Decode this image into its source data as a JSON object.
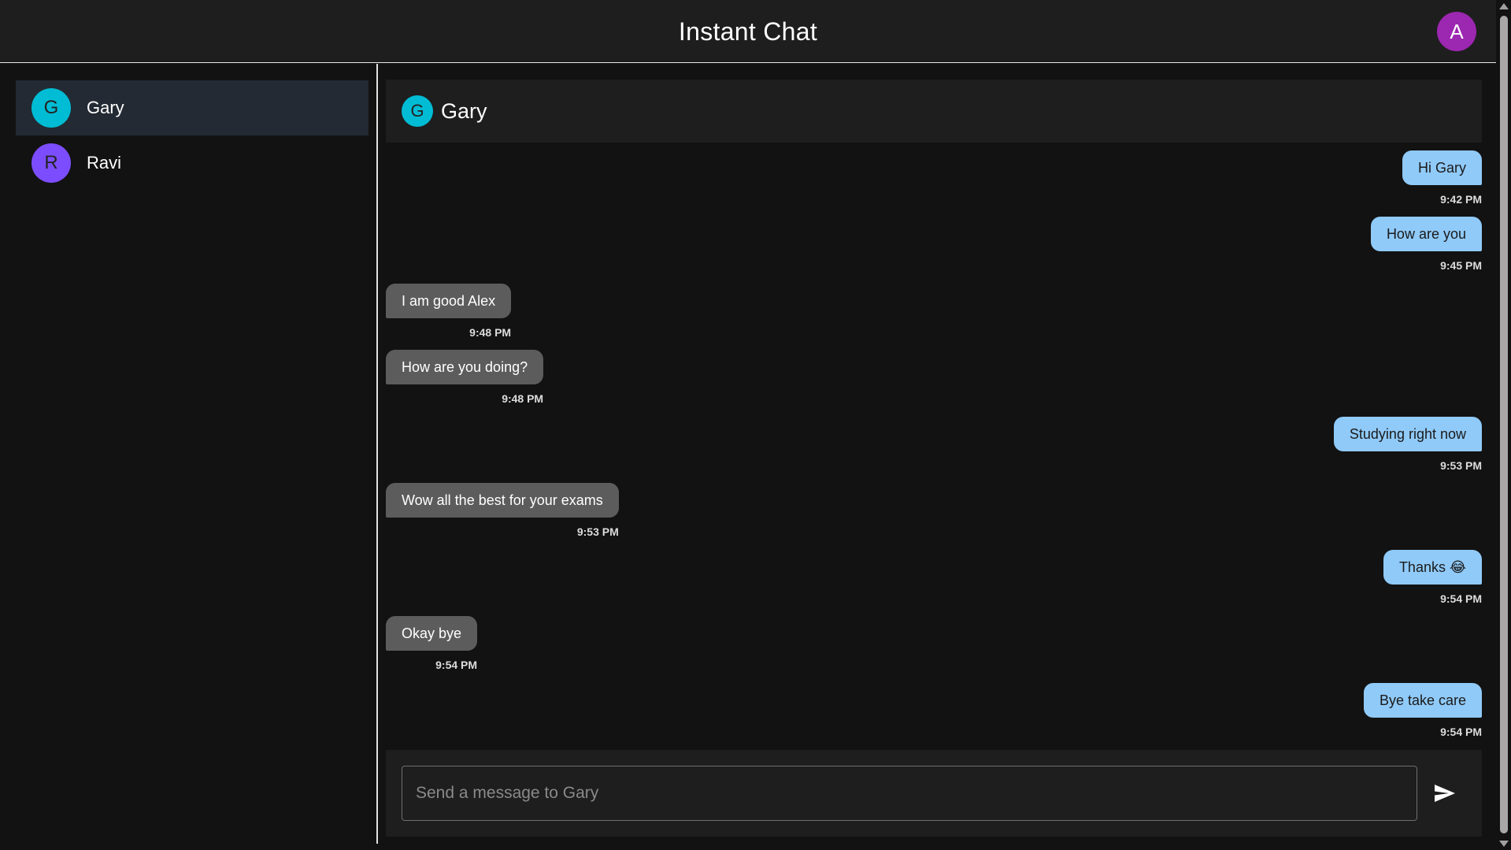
{
  "app": {
    "title": "Instant Chat"
  },
  "user": {
    "initial": "A",
    "avatar_color": "#9c27b0"
  },
  "contacts": [
    {
      "initial": "G",
      "name": "Gary",
      "avatar_color": "#00bcd4",
      "active": true
    },
    {
      "initial": "R",
      "name": "Ravi",
      "avatar_color": "#7c4dff",
      "active": false
    }
  ],
  "chat": {
    "contact_initial": "G",
    "contact_name": "Gary",
    "contact_color": "#00bcd4",
    "messages": [
      {
        "direction": "out",
        "text": "Hi Gary",
        "time": "9:42 PM"
      },
      {
        "direction": "out",
        "text": "How are you",
        "time": "9:45 PM"
      },
      {
        "direction": "in",
        "text": "I am good Alex",
        "time": "9:48 PM"
      },
      {
        "direction": "in",
        "text": "How are you doing?",
        "time": "9:48 PM"
      },
      {
        "direction": "out",
        "text": "Studying right now",
        "time": "9:53 PM"
      },
      {
        "direction": "in",
        "text": "Wow all the best for your exams",
        "time": "9:53 PM"
      },
      {
        "direction": "out",
        "text": "Thanks 😂",
        "time": "9:54 PM"
      },
      {
        "direction": "in",
        "text": "Okay bye",
        "time": "9:54 PM"
      },
      {
        "direction": "out",
        "text": "Bye take care",
        "time": "9:54 PM"
      }
    ],
    "input_placeholder": "Send a message to Gary",
    "input_value": ""
  },
  "colors": {
    "outgoing_bubble": "#90caf9",
    "incoming_bubble": "#5c5c5c",
    "background": "#121212",
    "panel": "#1e1e1e"
  },
  "icons": {
    "send": "send-icon"
  }
}
